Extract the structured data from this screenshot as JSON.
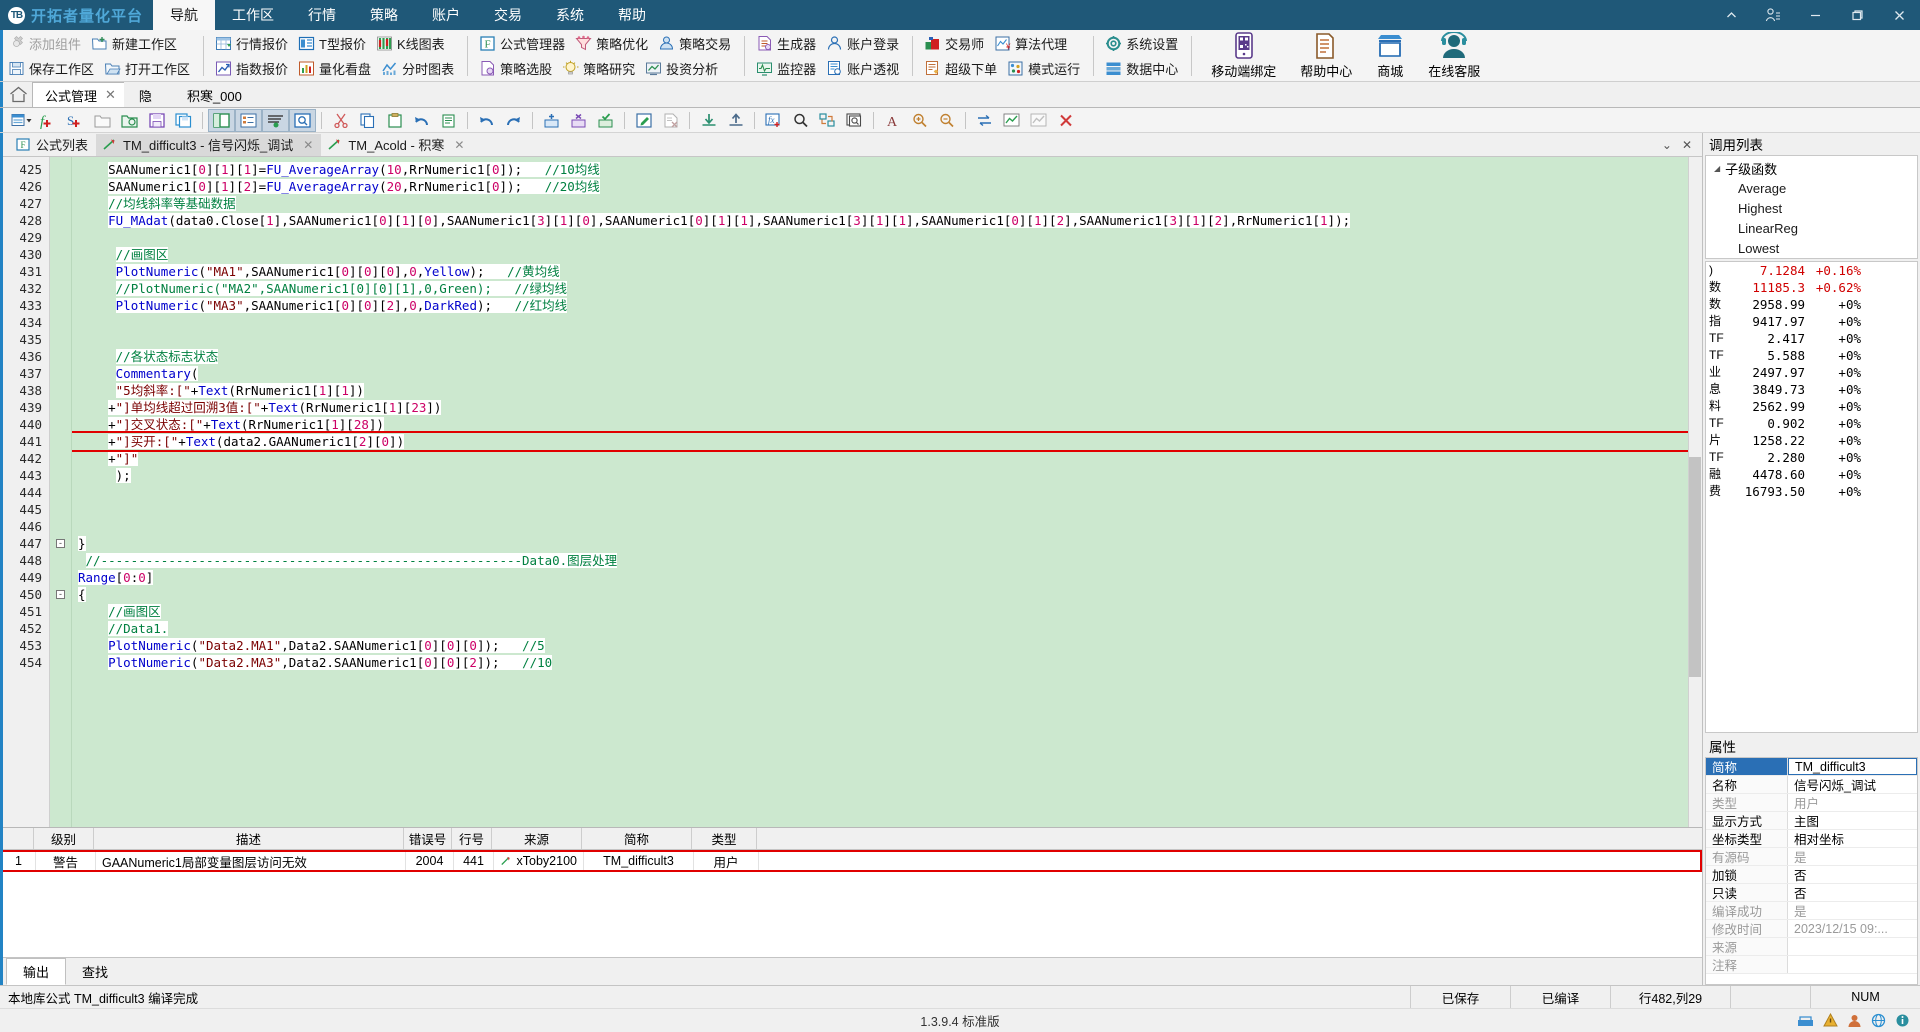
{
  "titlebar": {
    "logo_text": "TB",
    "brand": "开拓者量化平台",
    "menus": [
      {
        "label": "导航",
        "active": true
      },
      {
        "label": "工作区",
        "active": false
      },
      {
        "label": "行情",
        "active": false
      },
      {
        "label": "策略",
        "active": false
      },
      {
        "label": "账户",
        "active": false
      },
      {
        "label": "交易",
        "active": false
      },
      {
        "label": "系统",
        "active": false
      },
      {
        "label": "帮助",
        "active": false
      }
    ],
    "window_controls": [
      {
        "name": "chevron-up-icon",
        "label": "^"
      },
      {
        "name": "user-account-icon",
        "label": "user"
      },
      {
        "name": "minimize-icon",
        "label": "—"
      },
      {
        "name": "restore-icon",
        "label": "❐"
      },
      {
        "name": "close-icon",
        "label": "✕"
      }
    ]
  },
  "ribbon": {
    "groups": [
      {
        "rows": [
          [
            {
              "label": "添加组件",
              "icon": "add-component-icon",
              "disabled": true
            },
            {
              "label": "新建工作区",
              "icon": "new-workspace-icon",
              "disabled": false
            }
          ],
          [
            {
              "label": "保存工作区",
              "icon": "save-workspace-icon",
              "disabled": false
            },
            {
              "label": "打开工作区",
              "icon": "open-workspace-icon",
              "disabled": false
            }
          ]
        ]
      },
      {
        "rows": [
          [
            {
              "label": "行情报价",
              "icon": "quote-table-icon",
              "disabled": false
            },
            {
              "label": "T型报价",
              "icon": "t-quote-icon",
              "disabled": false
            },
            {
              "label": "K线图表",
              "icon": "candlestick-icon",
              "disabled": false
            }
          ],
          [
            {
              "label": "指数报价",
              "icon": "index-quote-icon",
              "disabled": false
            },
            {
              "label": "量化看盘",
              "icon": "quant-board-icon",
              "disabled": false
            },
            {
              "label": "分时图表",
              "icon": "timeshare-chart-icon",
              "disabled": false
            }
          ]
        ]
      },
      {
        "rows": [
          [
            {
              "label": "公式管理器",
              "icon": "formula-manager-icon",
              "disabled": false
            },
            {
              "label": "策略优化",
              "icon": "strategy-optimize-icon",
              "disabled": false
            },
            {
              "label": "策略交易",
              "icon": "strategy-trade-icon",
              "disabled": false
            }
          ],
          [
            {
              "label": "策略选股",
              "icon": "strategy-stockpick-icon",
              "disabled": false
            },
            {
              "label": "策略研究",
              "icon": "strategy-research-icon",
              "disabled": false
            },
            {
              "label": "投资分析",
              "icon": "investment-analysis-icon",
              "disabled": false
            }
          ]
        ]
      },
      {
        "rows": [
          [
            {
              "label": "生成器",
              "icon": "generator-icon",
              "disabled": false
            },
            {
              "label": "账户登录",
              "icon": "account-login-icon",
              "disabled": false
            }
          ],
          [
            {
              "label": "监控器",
              "icon": "monitor-icon",
              "disabled": false
            },
            {
              "label": "账户透视",
              "icon": "account-view-icon",
              "disabled": false
            }
          ]
        ]
      },
      {
        "rows": [
          [
            {
              "label": "交易师",
              "icon": "trader-icon",
              "disabled": false
            },
            {
              "label": "算法代理",
              "icon": "algo-agent-icon",
              "disabled": false
            }
          ],
          [
            {
              "label": "超级下单",
              "icon": "super-order-icon",
              "disabled": false
            },
            {
              "label": "模式运行",
              "icon": "mode-run-icon",
              "disabled": false
            }
          ]
        ]
      },
      {
        "rows": [
          [
            {
              "label": "系统设置",
              "icon": "settings-gear-icon",
              "disabled": false
            }
          ],
          [
            {
              "label": "数据中心",
              "icon": "data-center-icon",
              "disabled": false
            }
          ]
        ]
      }
    ],
    "big_buttons": [
      {
        "label": "移动端绑定",
        "icon": "mobile-bind-icon"
      },
      {
        "label": "帮助中心",
        "icon": "help-center-icon"
      },
      {
        "label": "商城",
        "icon": "shop-icon"
      },
      {
        "label": "在线客服",
        "icon": "online-service-icon"
      }
    ]
  },
  "doctabs": {
    "home_icon": "home-icon",
    "tabs": [
      {
        "label": "公式管理",
        "closable": true,
        "active": true
      },
      {
        "label": "隐",
        "closable": false,
        "active": false
      },
      {
        "label": "积寒_000",
        "closable": false,
        "active": false
      }
    ]
  },
  "editor_toolbar": {
    "icons": [
      {
        "name": "new-formula-dropdown-icon",
        "active": false
      },
      {
        "name": "add-function-icon",
        "active": false
      },
      {
        "name": "add-signal-icon",
        "active": false
      },
      {
        "name": "open-folder-icon",
        "active": false
      },
      {
        "name": "open-file-icon",
        "active": false
      },
      {
        "name": "save-icon",
        "active": false
      },
      {
        "name": "save-all-icon",
        "active": false
      },
      {
        "name": "toggle-panel-icon",
        "active": true
      },
      {
        "name": "outline-tree-icon",
        "active": true
      },
      {
        "name": "code-list-icon",
        "active": true
      },
      {
        "name": "inspect-window-icon",
        "active": true
      },
      {
        "name": "cut-icon",
        "active": false
      },
      {
        "name": "copy-icon",
        "active": false
      },
      {
        "name": "paste-icon",
        "active": false
      },
      {
        "name": "undo-icon",
        "active": false
      },
      {
        "name": "clipboard-history-icon",
        "active": false
      },
      {
        "name": "undo2-icon",
        "active": false
      },
      {
        "name": "redo-icon",
        "active": false
      },
      {
        "name": "insert-bp-icon",
        "active": false
      },
      {
        "name": "remove-bp-icon",
        "active": false
      },
      {
        "name": "check-bp-icon",
        "active": false
      },
      {
        "name": "edit-icon",
        "active": false
      },
      {
        "name": "clear-doc-icon",
        "active": false
      },
      {
        "name": "import-icon",
        "active": false
      },
      {
        "name": "export-icon",
        "active": false
      },
      {
        "name": "fx-insert-icon",
        "active": false
      },
      {
        "name": "search-icon",
        "active": false
      },
      {
        "name": "replace-icon",
        "active": false
      },
      {
        "name": "preview-icon",
        "active": false
      },
      {
        "name": "font-icon",
        "active": false
      },
      {
        "name": "zoom-in-icon",
        "active": false
      },
      {
        "name": "zoom-out-icon",
        "active": false
      },
      {
        "name": "refresh-icon",
        "active": false
      },
      {
        "name": "chart-icon",
        "active": false
      },
      {
        "name": "chart-off-icon",
        "active": false
      },
      {
        "name": "stop-icon",
        "active": false
      }
    ]
  },
  "file_tabs": [
    {
      "label": "公式列表",
      "icon": "formula-list-icon",
      "selected": false,
      "closable": false
    },
    {
      "label": "TM_difficult3 - 信号闪烁_调试",
      "icon": "formula-icon",
      "selected": true,
      "closable": true
    },
    {
      "label": "TM_Acold - 积寒",
      "icon": "formula-icon",
      "selected": false,
      "closable": true
    }
  ],
  "code": {
    "first_line": 425,
    "lines": [
      {
        "n": 425,
        "fold": "",
        "text": "    SAANumeric1[0][1][1]=FU_AverageArray(10,RrNumeric1[0]);   //10均线"
      },
      {
        "n": 426,
        "fold": "",
        "text": "    SAANumeric1[0][1][2]=FU_AverageArray(20,RrNumeric1[0]);   //20均线"
      },
      {
        "n": 427,
        "fold": "",
        "text": "    //均线斜率等基础数据"
      },
      {
        "n": 428,
        "fold": "",
        "text": "    FU_MAdat(data0.Close[1],SAANumeric1[0][1][0],SAANumeric1[3][1][0],SAANumeric1[0][1][1],SAANumeric1[3][1][1],SAANumeric1[0][1][2],SAANumeric1[3][1][2],RrNumeric1[1]);"
      },
      {
        "n": 429,
        "fold": "",
        "text": ""
      },
      {
        "n": 430,
        "fold": "",
        "text": "     //画图区"
      },
      {
        "n": 431,
        "fold": "",
        "text": "     PlotNumeric(\"MA1\",SAANumeric1[0][0][0],0,Yellow);   //黄均线"
      },
      {
        "n": 432,
        "fold": "",
        "text": "     //PlotNumeric(\"MA2\",SAANumeric1[0][0][1],0,Green);   //绿均线"
      },
      {
        "n": 433,
        "fold": "",
        "text": "     PlotNumeric(\"MA3\",SAANumeric1[0][0][2],0,DarkRed);   //红均线"
      },
      {
        "n": 434,
        "fold": "",
        "text": ""
      },
      {
        "n": 435,
        "fold": "",
        "text": ""
      },
      {
        "n": 436,
        "fold": "",
        "text": "     //各状态标志状态"
      },
      {
        "n": 437,
        "fold": "",
        "text": "     Commentary("
      },
      {
        "n": 438,
        "fold": "",
        "text": "     \"5均斜率:[\"+Text(RrNumeric1[1][1])"
      },
      {
        "n": 439,
        "fold": "",
        "text": "    +\"]单均线超过回溯3值:[\"+Text(RrNumeric1[1][23])"
      },
      {
        "n": 440,
        "fold": "",
        "text": "    +\"]交叉状态:[\"+Text(RrNumeric1[1][28])"
      },
      {
        "n": 441,
        "fold": "",
        "text": "    +\"]买开:[\"+Text(data2.GAANumeric1[2][0])",
        "highlight": true
      },
      {
        "n": 442,
        "fold": "",
        "text": "    +\"]\""
      },
      {
        "n": 443,
        "fold": "",
        "text": "     );"
      },
      {
        "n": 444,
        "fold": "",
        "text": ""
      },
      {
        "n": 445,
        "fold": "",
        "text": ""
      },
      {
        "n": 446,
        "fold": "",
        "text": ""
      },
      {
        "n": 447,
        "fold": "-",
        "text": "}"
      },
      {
        "n": 448,
        "fold": "",
        "text": " //--------------------------------------------------------Data0.图层处理"
      },
      {
        "n": 449,
        "fold": "",
        "text": "Range[0:0]"
      },
      {
        "n": 450,
        "fold": "-",
        "text": "{"
      },
      {
        "n": 451,
        "fold": "",
        "text": "    //画图区"
      },
      {
        "n": 452,
        "fold": "",
        "text": "    //Data1."
      },
      {
        "n": 453,
        "fold": "",
        "text": "    PlotNumeric(\"Data2.MA1\",Data2.SAANumeric1[0][0][0]);   //5"
      },
      {
        "n": 454,
        "fold": "",
        "text": "    PlotNumeric(\"Data2.MA3\",Data2.SAANumeric1[0][0][2]);   //10"
      }
    ]
  },
  "error_panel": {
    "columns": [
      "",
      "级别",
      "描述",
      "错误号",
      "行号",
      "来源",
      "简称",
      "类型"
    ],
    "rows": [
      {
        "index": "1",
        "level": "警告",
        "description": "GAANumeric1局部变量图层访问无效",
        "error_no": "2004",
        "line_no": "441",
        "source": "xToby2100",
        "abbr": "TM_difficult3",
        "type": "用户"
      }
    ]
  },
  "bottom_tabs": [
    {
      "label": "输出",
      "selected": true
    },
    {
      "label": "查找",
      "selected": false
    }
  ],
  "call_list": {
    "title": "调用列表",
    "root": "子级函数",
    "items": [
      "Average",
      "Highest",
      "LinearReg",
      "Lowest"
    ]
  },
  "quotes": [
    {
      "name": ")",
      "value": "7.1284",
      "change": "+0.16%",
      "up": true
    },
    {
      "name": "数",
      "value": "11185.3",
      "change": "+0.62%",
      "up": true
    },
    {
      "name": "数",
      "value": "2958.99",
      "change": "+0%",
      "up": false
    },
    {
      "name": "指",
      "value": "9417.97",
      "change": "+0%",
      "up": false
    },
    {
      "name": "TF",
      "value": "2.417",
      "change": "+0%",
      "up": false
    },
    {
      "name": "TF",
      "value": "5.588",
      "change": "+0%",
      "up": false
    },
    {
      "name": "业",
      "value": "2497.97",
      "change": "+0%",
      "up": false
    },
    {
      "name": "息",
      "value": "3849.73",
      "change": "+0%",
      "up": false
    },
    {
      "name": "料",
      "value": "2562.99",
      "change": "+0%",
      "up": false
    },
    {
      "name": "TF",
      "value": "0.902",
      "change": "+0%",
      "up": false
    },
    {
      "name": "片",
      "value": "1258.22",
      "change": "+0%",
      "up": false
    },
    {
      "name": "TF",
      "value": "2.280",
      "change": "+0%",
      "up": false
    },
    {
      "name": "融",
      "value": "4478.60",
      "change": "+0%",
      "up": false
    },
    {
      "name": "费",
      "value": "16793.50",
      "change": "+0%",
      "up": false
    }
  ],
  "properties": {
    "title": "属性",
    "rows": [
      {
        "key": "简称",
        "value": "TM_difficult3",
        "selected": true,
        "dim": false
      },
      {
        "key": "名称",
        "value": "信号闪烁_调试",
        "selected": false,
        "dim": false
      },
      {
        "key": "类型",
        "value": "用户",
        "selected": false,
        "dim": true
      },
      {
        "key": "显示方式",
        "value": "主图",
        "selected": false,
        "dim": false
      },
      {
        "key": "坐标类型",
        "value": "相对坐标",
        "selected": false,
        "dim": false
      },
      {
        "key": "有源码",
        "value": "是",
        "selected": false,
        "dim": true
      },
      {
        "key": "加锁",
        "value": "否",
        "selected": false,
        "dim": false
      },
      {
        "key": "只读",
        "value": "否",
        "selected": false,
        "dim": false
      },
      {
        "key": "编译成功",
        "value": "是",
        "selected": false,
        "dim": true
      },
      {
        "key": "修改时间",
        "value": "2023/12/15 09:...",
        "selected": false,
        "dim": true
      },
      {
        "key": "来源",
        "value": "",
        "selected": false,
        "dim": true
      },
      {
        "key": "注释",
        "value": "",
        "selected": false,
        "dim": true
      }
    ]
  },
  "statusbar": {
    "message": "本地库公式 TM_difficult3 编译完成",
    "saved": "已保存",
    "compiled": "已编译",
    "position": "行482,列29",
    "num": "NUM"
  },
  "versionbar": {
    "version": "1.3.9.4 标准版",
    "tray_icons": [
      "network-icon",
      "alert-icon",
      "user-icon",
      "globe-icon",
      "info-icon"
    ]
  },
  "colors": {
    "titlebar_bg": "#1f5878",
    "brand": "#4fa8d8",
    "accent": "#2283c4",
    "code_bg": "#cce8cf",
    "error_outline": "#e00000",
    "keyword": "#0000cc",
    "number": "#cc0066",
    "comment": "#008040",
    "up": "#d00000"
  }
}
